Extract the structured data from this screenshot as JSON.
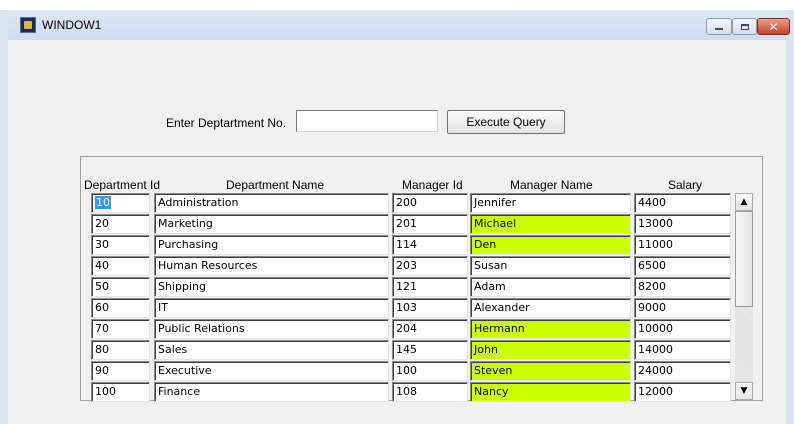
{
  "window": {
    "title": "WINDOW1",
    "icon": "app-icon",
    "controls": {
      "minimize": "minimize-icon",
      "maximize": "maximize-icon",
      "close_glyph": "✕"
    }
  },
  "form": {
    "label": "Enter Deptartment No.",
    "input_value": "",
    "button_label": "Execute Query"
  },
  "table": {
    "columns": [
      "Department Id",
      "Department Name",
      "Manager Id",
      "Manager Name",
      "Salary"
    ],
    "rows": [
      {
        "dept_id": "10",
        "dept_name": "Administration",
        "mgr_id": "200",
        "mgr_name": "Jennifer",
        "salary": "4400",
        "highlight": false,
        "selected": true
      },
      {
        "dept_id": "20",
        "dept_name": "Marketing",
        "mgr_id": "201",
        "mgr_name": "Michael",
        "salary": "13000",
        "highlight": true,
        "selected": false
      },
      {
        "dept_id": "30",
        "dept_name": "Purchasing",
        "mgr_id": "114",
        "mgr_name": "Den",
        "salary": "11000",
        "highlight": true,
        "selected": false
      },
      {
        "dept_id": "40",
        "dept_name": "Human Resources",
        "mgr_id": "203",
        "mgr_name": "Susan",
        "salary": "6500",
        "highlight": false,
        "selected": false
      },
      {
        "dept_id": "50",
        "dept_name": "Shipping",
        "mgr_id": "121",
        "mgr_name": "Adam",
        "salary": "8200",
        "highlight": false,
        "selected": false
      },
      {
        "dept_id": "60",
        "dept_name": "IT",
        "mgr_id": "103",
        "mgr_name": "Alexander",
        "salary": "9000",
        "highlight": false,
        "selected": false
      },
      {
        "dept_id": "70",
        "dept_name": "Public Relations",
        "mgr_id": "204",
        "mgr_name": "Hermann",
        "salary": "10000",
        "highlight": true,
        "selected": false
      },
      {
        "dept_id": "80",
        "dept_name": "Sales",
        "mgr_id": "145",
        "mgr_name": "John",
        "salary": "14000",
        "highlight": true,
        "selected": false
      },
      {
        "dept_id": "90",
        "dept_name": "Executive",
        "mgr_id": "100",
        "mgr_name": "Steven",
        "salary": "24000",
        "highlight": true,
        "selected": false
      },
      {
        "dept_id": "100",
        "dept_name": "Finance",
        "mgr_id": "108",
        "mgr_name": "Nancy",
        "salary": "12000",
        "highlight": true,
        "selected": false
      }
    ]
  },
  "scrollbar": {
    "up_glyph": "▲",
    "down_glyph": "▼"
  },
  "colors": {
    "highlight": "#ccff00",
    "selection": "#3399ff",
    "client_background": "#f0f0f0"
  }
}
